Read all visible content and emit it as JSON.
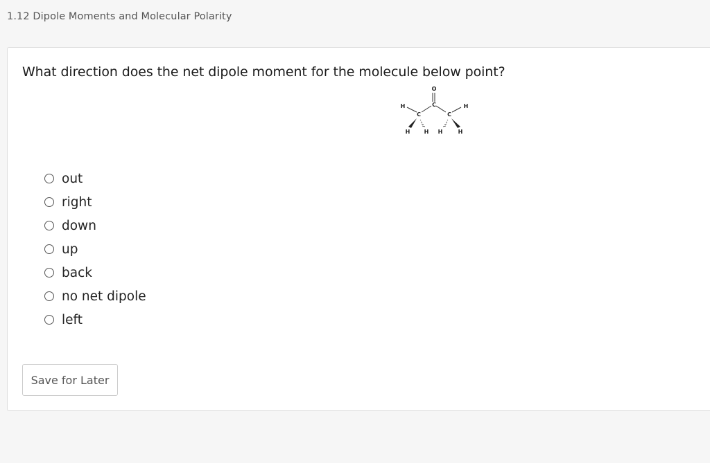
{
  "header": {
    "title": "1.12 Dipole Moments and Molecular Polarity"
  },
  "question": {
    "text": "What direction does the net dipole moment for the molecule below point?"
  },
  "molecule": {
    "atoms": [
      "O",
      "C",
      "C",
      "C",
      "H",
      "H",
      "H",
      "H",
      "H",
      "H"
    ]
  },
  "options": [
    {
      "label": "out"
    },
    {
      "label": "right"
    },
    {
      "label": "down"
    },
    {
      "label": "up"
    },
    {
      "label": "back"
    },
    {
      "label": "no net dipole"
    },
    {
      "label": "left"
    }
  ],
  "actions": {
    "save_label": "Save for Later"
  }
}
